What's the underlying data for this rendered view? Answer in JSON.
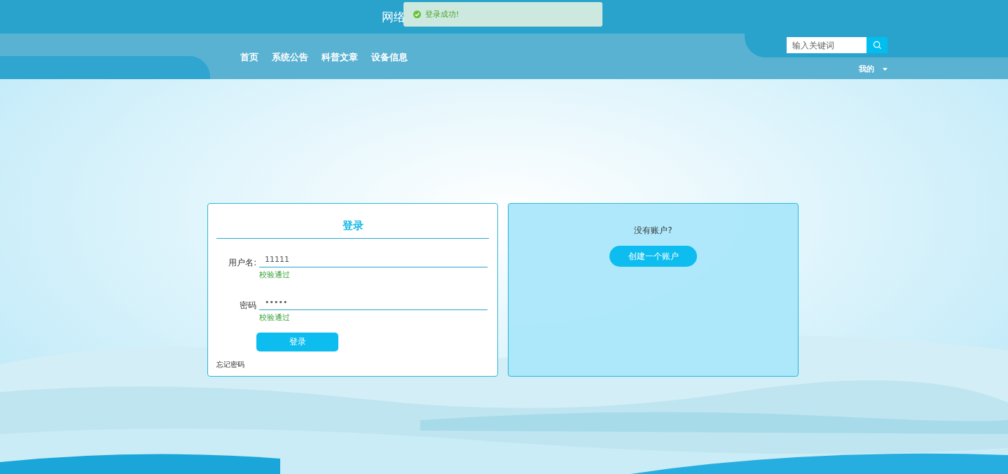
{
  "header": {
    "title": "网络"
  },
  "toast": {
    "message": "登录成功!"
  },
  "nav": {
    "items": [
      {
        "label": "首页"
      },
      {
        "label": "系统公告"
      },
      {
        "label": "科普文章"
      },
      {
        "label": "设备信息"
      }
    ]
  },
  "search": {
    "placeholder": "输入关键词"
  },
  "user_menu": {
    "label": "我的"
  },
  "login": {
    "title": "登录",
    "fields": [
      {
        "label": "用户名:",
        "value": "11111",
        "hint": "校验通过"
      },
      {
        "label": "密码",
        "value": "•••••",
        "hint": "校验通过"
      }
    ],
    "button": "登录",
    "forgot": "忘记密码"
  },
  "register": {
    "question": "没有账户?",
    "button": "创建一个账户"
  }
}
